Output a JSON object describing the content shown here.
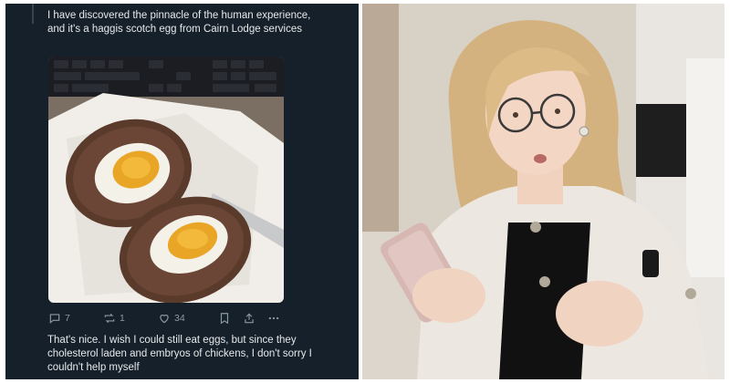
{
  "post": {
    "text": "I have discovered the pinnacle of the human experience, and it's a haggis scotch egg from Cairn Lodge services",
    "image_alt": "Haggis scotch egg cut in half on paper in front of a keyboard"
  },
  "actions": {
    "reply_count": "7",
    "repost_count": "1",
    "like_count": "34"
  },
  "reply": {
    "text": "That's nice. I wish I could still eat eggs, but since they cholesterol laden and embryos of chickens, I don't sorry I couldn't help myself"
  },
  "photo": {
    "description": "Woman with glasses looking surprised at her phone"
  },
  "colors": {
    "post_background": "#15202b",
    "text": "#e7e9ea",
    "muted": "#8b98a5"
  }
}
